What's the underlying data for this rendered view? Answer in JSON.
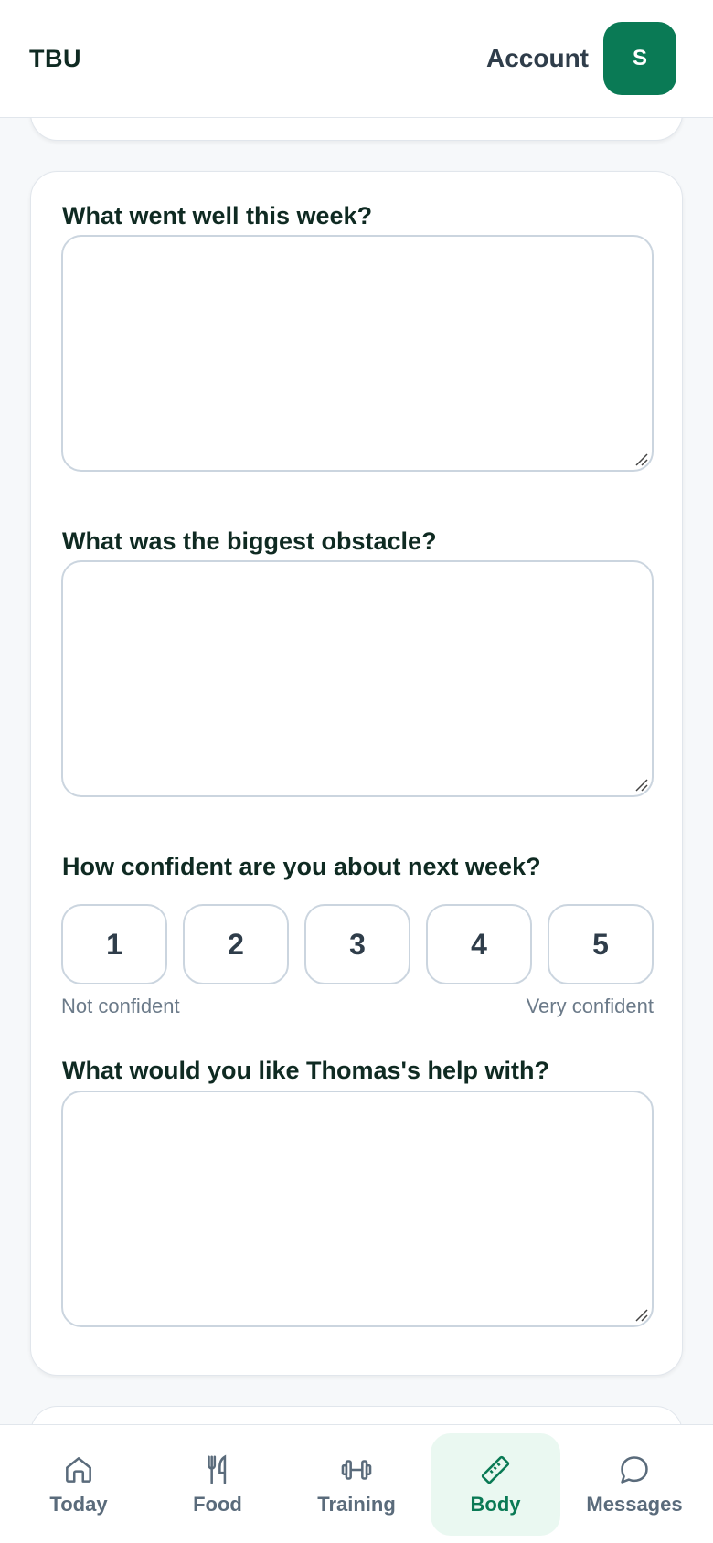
{
  "header": {
    "brand": "TBU",
    "account_label": "Account",
    "avatar_initial": "S"
  },
  "form": {
    "q1": {
      "label": "What went well this week?",
      "value": ""
    },
    "q2": {
      "label": "What was the biggest obstacle?",
      "value": ""
    },
    "q3": {
      "label": "How confident are you about next week?",
      "options": [
        "1",
        "2",
        "3",
        "4",
        "5"
      ],
      "low_hint": "Not confident",
      "high_hint": "Very confident"
    },
    "q4": {
      "label": "What would you like Thomas's help with?",
      "value": ""
    }
  },
  "nav": {
    "items": [
      {
        "label": "Today",
        "icon": "home-icon",
        "active": false
      },
      {
        "label": "Food",
        "icon": "utensils-icon",
        "active": false
      },
      {
        "label": "Training",
        "icon": "dumbbell-icon",
        "active": false
      },
      {
        "label": "Body",
        "icon": "ruler-icon",
        "active": true
      },
      {
        "label": "Messages",
        "icon": "chat-bubble-icon",
        "active": false
      }
    ]
  },
  "colors": {
    "accent": "#0a7a55",
    "active_nav_bg": "#eaf8f1",
    "text_dark": "#0f2a22",
    "muted": "#6b7a89",
    "border": "#cbd5df"
  }
}
